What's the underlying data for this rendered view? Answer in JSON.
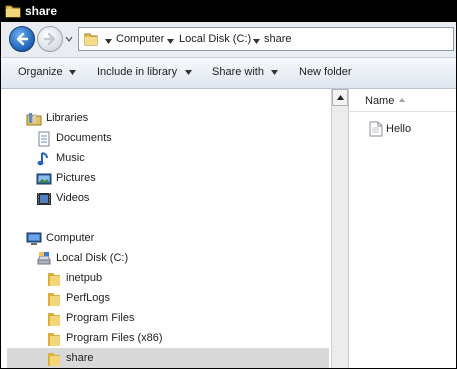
{
  "window": {
    "title": "share"
  },
  "address": {
    "crumbs": [
      "Computer",
      "Local Disk (C:)",
      "share"
    ]
  },
  "commands": {
    "organize": "Organize",
    "include_in_library": "Include in library",
    "share_with": "Share with",
    "new_folder": "New folder"
  },
  "tree": {
    "libraries": "Libraries",
    "documents": "Documents",
    "music": "Music",
    "pictures": "Pictures",
    "videos": "Videos",
    "computer": "Computer",
    "local_disk": "Local Disk (C:)",
    "folders": [
      "inetpub",
      "PerfLogs",
      "Program Files",
      "Program Files (x86)",
      "share"
    ]
  },
  "content": {
    "column_name": "Name",
    "files": [
      "Hello"
    ]
  }
}
